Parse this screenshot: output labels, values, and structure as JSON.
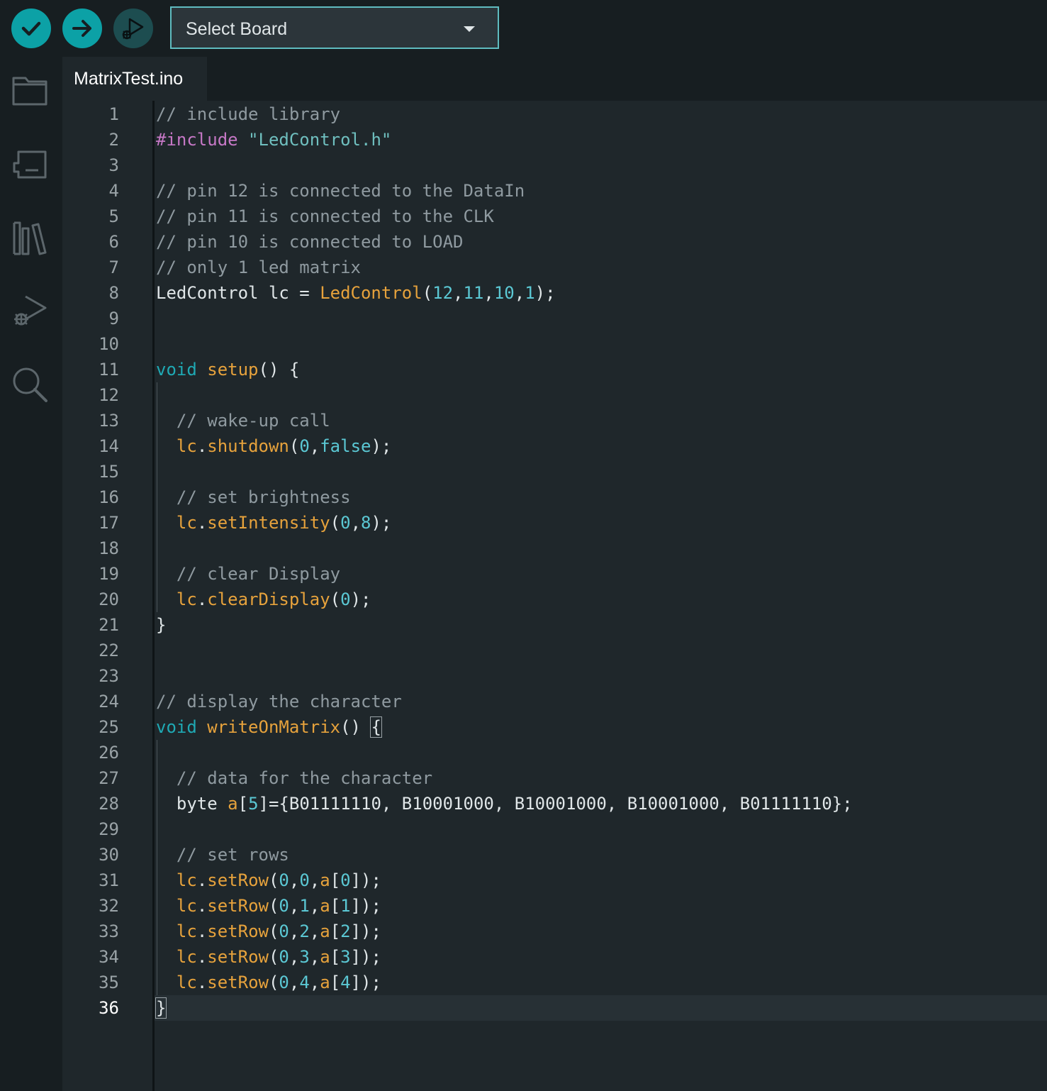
{
  "toolbar": {
    "verify_label": "Verify",
    "upload_label": "Upload",
    "debug_label": "Start Debugging",
    "board_select": "Select Board"
  },
  "sidebar": {
    "items": [
      "sketchbook",
      "boards-manager",
      "library-manager",
      "debug",
      "search"
    ]
  },
  "tabs": [
    {
      "label": "MatrixTest.ino",
      "active": true
    }
  ],
  "editor": {
    "active_line": 36,
    "lines": [
      {
        "n": "1",
        "tokens": [
          {
            "t": "// include library",
            "c": "comment"
          }
        ]
      },
      {
        "n": "2",
        "tokens": [
          {
            "t": "#include ",
            "c": "pre"
          },
          {
            "t": "\"LedControl.h\"",
            "c": "str"
          }
        ]
      },
      {
        "n": "3",
        "tokens": []
      },
      {
        "n": "4",
        "tokens": [
          {
            "t": "// pin 12 is connected to the DataIn",
            "c": "comment"
          }
        ]
      },
      {
        "n": "5",
        "tokens": [
          {
            "t": "// pin 11 is connected to the CLK",
            "c": "comment"
          }
        ]
      },
      {
        "n": "6",
        "tokens": [
          {
            "t": "// pin 10 is connected to LOAD",
            "c": "comment"
          }
        ]
      },
      {
        "n": "7",
        "tokens": [
          {
            "t": "// only 1 led matrix",
            "c": "comment"
          }
        ]
      },
      {
        "n": "8",
        "tokens": [
          {
            "t": "LedControl lc = ",
            "c": "plain"
          },
          {
            "t": "LedControl",
            "c": "fn"
          },
          {
            "t": "(",
            "c": "plain"
          },
          {
            "t": "12",
            "c": "num"
          },
          {
            "t": ",",
            "c": "plain"
          },
          {
            "t": "11",
            "c": "num"
          },
          {
            "t": ",",
            "c": "plain"
          },
          {
            "t": "10",
            "c": "num"
          },
          {
            "t": ",",
            "c": "plain"
          },
          {
            "t": "1",
            "c": "num"
          },
          {
            "t": ");",
            "c": "plain"
          }
        ]
      },
      {
        "n": "9",
        "tokens": []
      },
      {
        "n": "10",
        "tokens": []
      },
      {
        "n": "11",
        "tokens": [
          {
            "t": "void",
            "c": "kw"
          },
          {
            "t": " ",
            "c": "plain"
          },
          {
            "t": "setup",
            "c": "fn"
          },
          {
            "t": "() {",
            "c": "plain"
          }
        ]
      },
      {
        "n": "12",
        "guide": true,
        "tokens": []
      },
      {
        "n": "13",
        "guide": true,
        "tokens": [
          {
            "t": "  // wake-up call",
            "c": "comment"
          }
        ]
      },
      {
        "n": "14",
        "guide": true,
        "tokens": [
          {
            "t": "  ",
            "c": "plain"
          },
          {
            "t": "lc",
            "c": "var"
          },
          {
            "t": ".",
            "c": "plain"
          },
          {
            "t": "shutdown",
            "c": "fn"
          },
          {
            "t": "(",
            "c": "plain"
          },
          {
            "t": "0",
            "c": "num"
          },
          {
            "t": ",",
            "c": "plain"
          },
          {
            "t": "false",
            "c": "num"
          },
          {
            "t": ");",
            "c": "plain"
          }
        ]
      },
      {
        "n": "15",
        "guide": true,
        "tokens": []
      },
      {
        "n": "16",
        "guide": true,
        "tokens": [
          {
            "t": "  // set brightness",
            "c": "comment"
          }
        ]
      },
      {
        "n": "17",
        "guide": true,
        "tokens": [
          {
            "t": "  ",
            "c": "plain"
          },
          {
            "t": "lc",
            "c": "var"
          },
          {
            "t": ".",
            "c": "plain"
          },
          {
            "t": "setIntensity",
            "c": "fn"
          },
          {
            "t": "(",
            "c": "plain"
          },
          {
            "t": "0",
            "c": "num"
          },
          {
            "t": ",",
            "c": "plain"
          },
          {
            "t": "8",
            "c": "num"
          },
          {
            "t": ");",
            "c": "plain"
          }
        ]
      },
      {
        "n": "18",
        "guide": true,
        "tokens": []
      },
      {
        "n": "19",
        "guide": true,
        "tokens": [
          {
            "t": "  // clear Display",
            "c": "comment"
          }
        ]
      },
      {
        "n": "20",
        "guide": true,
        "tokens": [
          {
            "t": "  ",
            "c": "plain"
          },
          {
            "t": "lc",
            "c": "var"
          },
          {
            "t": ".",
            "c": "plain"
          },
          {
            "t": "clearDisplay",
            "c": "fn"
          },
          {
            "t": "(",
            "c": "plain"
          },
          {
            "t": "0",
            "c": "num"
          },
          {
            "t": ");",
            "c": "plain"
          }
        ]
      },
      {
        "n": "21",
        "tokens": [
          {
            "t": "}",
            "c": "plain"
          }
        ]
      },
      {
        "n": "22",
        "tokens": []
      },
      {
        "n": "23",
        "tokens": []
      },
      {
        "n": "24",
        "tokens": [
          {
            "t": "// display the character",
            "c": "comment"
          }
        ]
      },
      {
        "n": "25",
        "tokens": [
          {
            "t": "void",
            "c": "kw"
          },
          {
            "t": " ",
            "c": "plain"
          },
          {
            "t": "writeOnMatrix",
            "c": "fn"
          },
          {
            "t": "() ",
            "c": "plain"
          },
          {
            "t": "{",
            "c": "plain",
            "hl": true
          }
        ]
      },
      {
        "n": "26",
        "guide": true,
        "tokens": []
      },
      {
        "n": "27",
        "guide": true,
        "tokens": [
          {
            "t": "  // data for the character",
            "c": "comment"
          }
        ]
      },
      {
        "n": "28",
        "guide": true,
        "tokens": [
          {
            "t": "  byte ",
            "c": "plain"
          },
          {
            "t": "a",
            "c": "var"
          },
          {
            "t": "[",
            "c": "plain"
          },
          {
            "t": "5",
            "c": "num"
          },
          {
            "t": "]={B01111110, B10001000, B10001000, B10001000, B01111110};",
            "c": "plain"
          }
        ]
      },
      {
        "n": "29",
        "guide": true,
        "tokens": []
      },
      {
        "n": "30",
        "guide": true,
        "tokens": [
          {
            "t": "  // set rows",
            "c": "comment"
          }
        ]
      },
      {
        "n": "31",
        "guide": true,
        "tokens": [
          {
            "t": "  ",
            "c": "plain"
          },
          {
            "t": "lc",
            "c": "var"
          },
          {
            "t": ".",
            "c": "plain"
          },
          {
            "t": "setRow",
            "c": "fn"
          },
          {
            "t": "(",
            "c": "plain"
          },
          {
            "t": "0",
            "c": "num"
          },
          {
            "t": ",",
            "c": "plain"
          },
          {
            "t": "0",
            "c": "num"
          },
          {
            "t": ",",
            "c": "plain"
          },
          {
            "t": "a",
            "c": "var"
          },
          {
            "t": "[",
            "c": "plain"
          },
          {
            "t": "0",
            "c": "num"
          },
          {
            "t": "]);",
            "c": "plain"
          }
        ]
      },
      {
        "n": "32",
        "guide": true,
        "tokens": [
          {
            "t": "  ",
            "c": "plain"
          },
          {
            "t": "lc",
            "c": "var"
          },
          {
            "t": ".",
            "c": "plain"
          },
          {
            "t": "setRow",
            "c": "fn"
          },
          {
            "t": "(",
            "c": "plain"
          },
          {
            "t": "0",
            "c": "num"
          },
          {
            "t": ",",
            "c": "plain"
          },
          {
            "t": "1",
            "c": "num"
          },
          {
            "t": ",",
            "c": "plain"
          },
          {
            "t": "a",
            "c": "var"
          },
          {
            "t": "[",
            "c": "plain"
          },
          {
            "t": "1",
            "c": "num"
          },
          {
            "t": "]);",
            "c": "plain"
          }
        ]
      },
      {
        "n": "33",
        "guide": true,
        "tokens": [
          {
            "t": "  ",
            "c": "plain"
          },
          {
            "t": "lc",
            "c": "var"
          },
          {
            "t": ".",
            "c": "plain"
          },
          {
            "t": "setRow",
            "c": "fn"
          },
          {
            "t": "(",
            "c": "plain"
          },
          {
            "t": "0",
            "c": "num"
          },
          {
            "t": ",",
            "c": "plain"
          },
          {
            "t": "2",
            "c": "num"
          },
          {
            "t": ",",
            "c": "plain"
          },
          {
            "t": "a",
            "c": "var"
          },
          {
            "t": "[",
            "c": "plain"
          },
          {
            "t": "2",
            "c": "num"
          },
          {
            "t": "]);",
            "c": "plain"
          }
        ]
      },
      {
        "n": "34",
        "guide": true,
        "tokens": [
          {
            "t": "  ",
            "c": "plain"
          },
          {
            "t": "lc",
            "c": "var"
          },
          {
            "t": ".",
            "c": "plain"
          },
          {
            "t": "setRow",
            "c": "fn"
          },
          {
            "t": "(",
            "c": "plain"
          },
          {
            "t": "0",
            "c": "num"
          },
          {
            "t": ",",
            "c": "plain"
          },
          {
            "t": "3",
            "c": "num"
          },
          {
            "t": ",",
            "c": "plain"
          },
          {
            "t": "a",
            "c": "var"
          },
          {
            "t": "[",
            "c": "plain"
          },
          {
            "t": "3",
            "c": "num"
          },
          {
            "t": "]);",
            "c": "plain"
          }
        ]
      },
      {
        "n": "35",
        "guide": true,
        "tokens": [
          {
            "t": "  ",
            "c": "plain"
          },
          {
            "t": "lc",
            "c": "var"
          },
          {
            "t": ".",
            "c": "plain"
          },
          {
            "t": "setRow",
            "c": "fn"
          },
          {
            "t": "(",
            "c": "plain"
          },
          {
            "t": "0",
            "c": "num"
          },
          {
            "t": ",",
            "c": "plain"
          },
          {
            "t": "4",
            "c": "num"
          },
          {
            "t": ",",
            "c": "plain"
          },
          {
            "t": "a",
            "c": "var"
          },
          {
            "t": "[",
            "c": "plain"
          },
          {
            "t": "4",
            "c": "num"
          },
          {
            "t": "]);",
            "c": "plain"
          }
        ]
      },
      {
        "n": "36",
        "tokens": [
          {
            "t": "}",
            "c": "plain",
            "hl": true
          }
        ]
      }
    ]
  },
  "colors": {
    "accent": "#0ca1a6",
    "comment": "#8f9aa0",
    "keyword": "#1fa9b4",
    "function": "#e6a23c",
    "number": "#5bc8d4",
    "preprocessor": "#c678c6"
  }
}
